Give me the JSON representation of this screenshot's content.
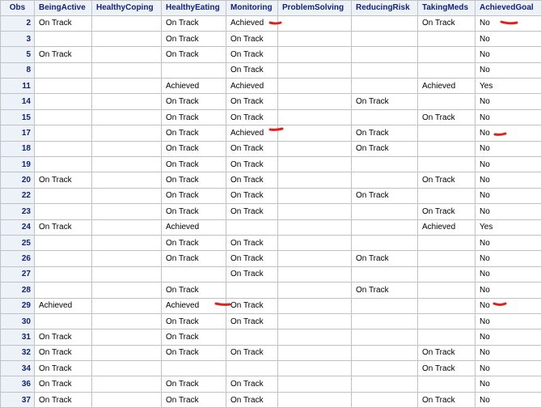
{
  "columns": [
    "Obs",
    "BeingActive",
    "HealthyCoping",
    "HealthyEating",
    "Monitoring",
    "ProblemSolving",
    "ReducingRisk",
    "TakingMeds",
    "AchievedGoal"
  ],
  "rows": [
    [
      "2",
      "On Track",
      "",
      "On Track",
      "Achieved",
      "",
      "",
      "On Track",
      "No"
    ],
    [
      "3",
      "",
      "",
      "On Track",
      "On Track",
      "",
      "",
      "",
      "No"
    ],
    [
      "5",
      "On Track",
      "",
      "On Track",
      "On Track",
      "",
      "",
      "",
      "No"
    ],
    [
      "8",
      "",
      "",
      "",
      "On Track",
      "",
      "",
      "",
      "No"
    ],
    [
      "11",
      "",
      "",
      "Achieved",
      "Achieved",
      "",
      "",
      "Achieved",
      "Yes"
    ],
    [
      "14",
      "",
      "",
      "On Track",
      "On Track",
      "",
      "On Track",
      "",
      "No"
    ],
    [
      "15",
      "",
      "",
      "On Track",
      "On Track",
      "",
      "",
      "On Track",
      "No"
    ],
    [
      "17",
      "",
      "",
      "On Track",
      "Achieved",
      "",
      "On Track",
      "",
      "No"
    ],
    [
      "18",
      "",
      "",
      "On Track",
      "On Track",
      "",
      "On Track",
      "",
      "No"
    ],
    [
      "19",
      "",
      "",
      "On Track",
      "On Track",
      "",
      "",
      "",
      "No"
    ],
    [
      "20",
      "On Track",
      "",
      "On Track",
      "On Track",
      "",
      "",
      "On Track",
      "No"
    ],
    [
      "22",
      "",
      "",
      "On Track",
      "On Track",
      "",
      "On Track",
      "",
      "No"
    ],
    [
      "23",
      "",
      "",
      "On Track",
      "On Track",
      "",
      "",
      "On Track",
      "No"
    ],
    [
      "24",
      "On Track",
      "",
      "Achieved",
      "",
      "",
      "",
      "Achieved",
      "Yes"
    ],
    [
      "25",
      "",
      "",
      "On Track",
      "On Track",
      "",
      "",
      "",
      "No"
    ],
    [
      "26",
      "",
      "",
      "On Track",
      "On Track",
      "",
      "On Track",
      "",
      "No"
    ],
    [
      "27",
      "",
      "",
      "",
      "On Track",
      "",
      "",
      "",
      "No"
    ],
    [
      "28",
      "",
      "",
      "On Track",
      "",
      "",
      "On Track",
      "",
      "No"
    ],
    [
      "29",
      "Achieved",
      "",
      "Achieved",
      "On Track",
      "",
      "",
      "",
      "No"
    ],
    [
      "30",
      "",
      "",
      "On Track",
      "On Track",
      "",
      "",
      "",
      "No"
    ],
    [
      "31",
      "On Track",
      "",
      "On Track",
      "",
      "",
      "",
      "",
      "No"
    ],
    [
      "32",
      "On Track",
      "",
      "On Track",
      "On Track",
      "",
      "",
      "On Track",
      "No"
    ],
    [
      "34",
      "On Track",
      "",
      "",
      "",
      "",
      "",
      "On Track",
      "No"
    ],
    [
      "36",
      "On Track",
      "",
      "On Track",
      "On Track",
      "",
      "",
      "",
      "No"
    ],
    [
      "37",
      "On Track",
      "",
      "On Track",
      "On Track",
      "",
      "",
      "On Track",
      "No"
    ]
  ],
  "annotation_color": "#e0201b"
}
